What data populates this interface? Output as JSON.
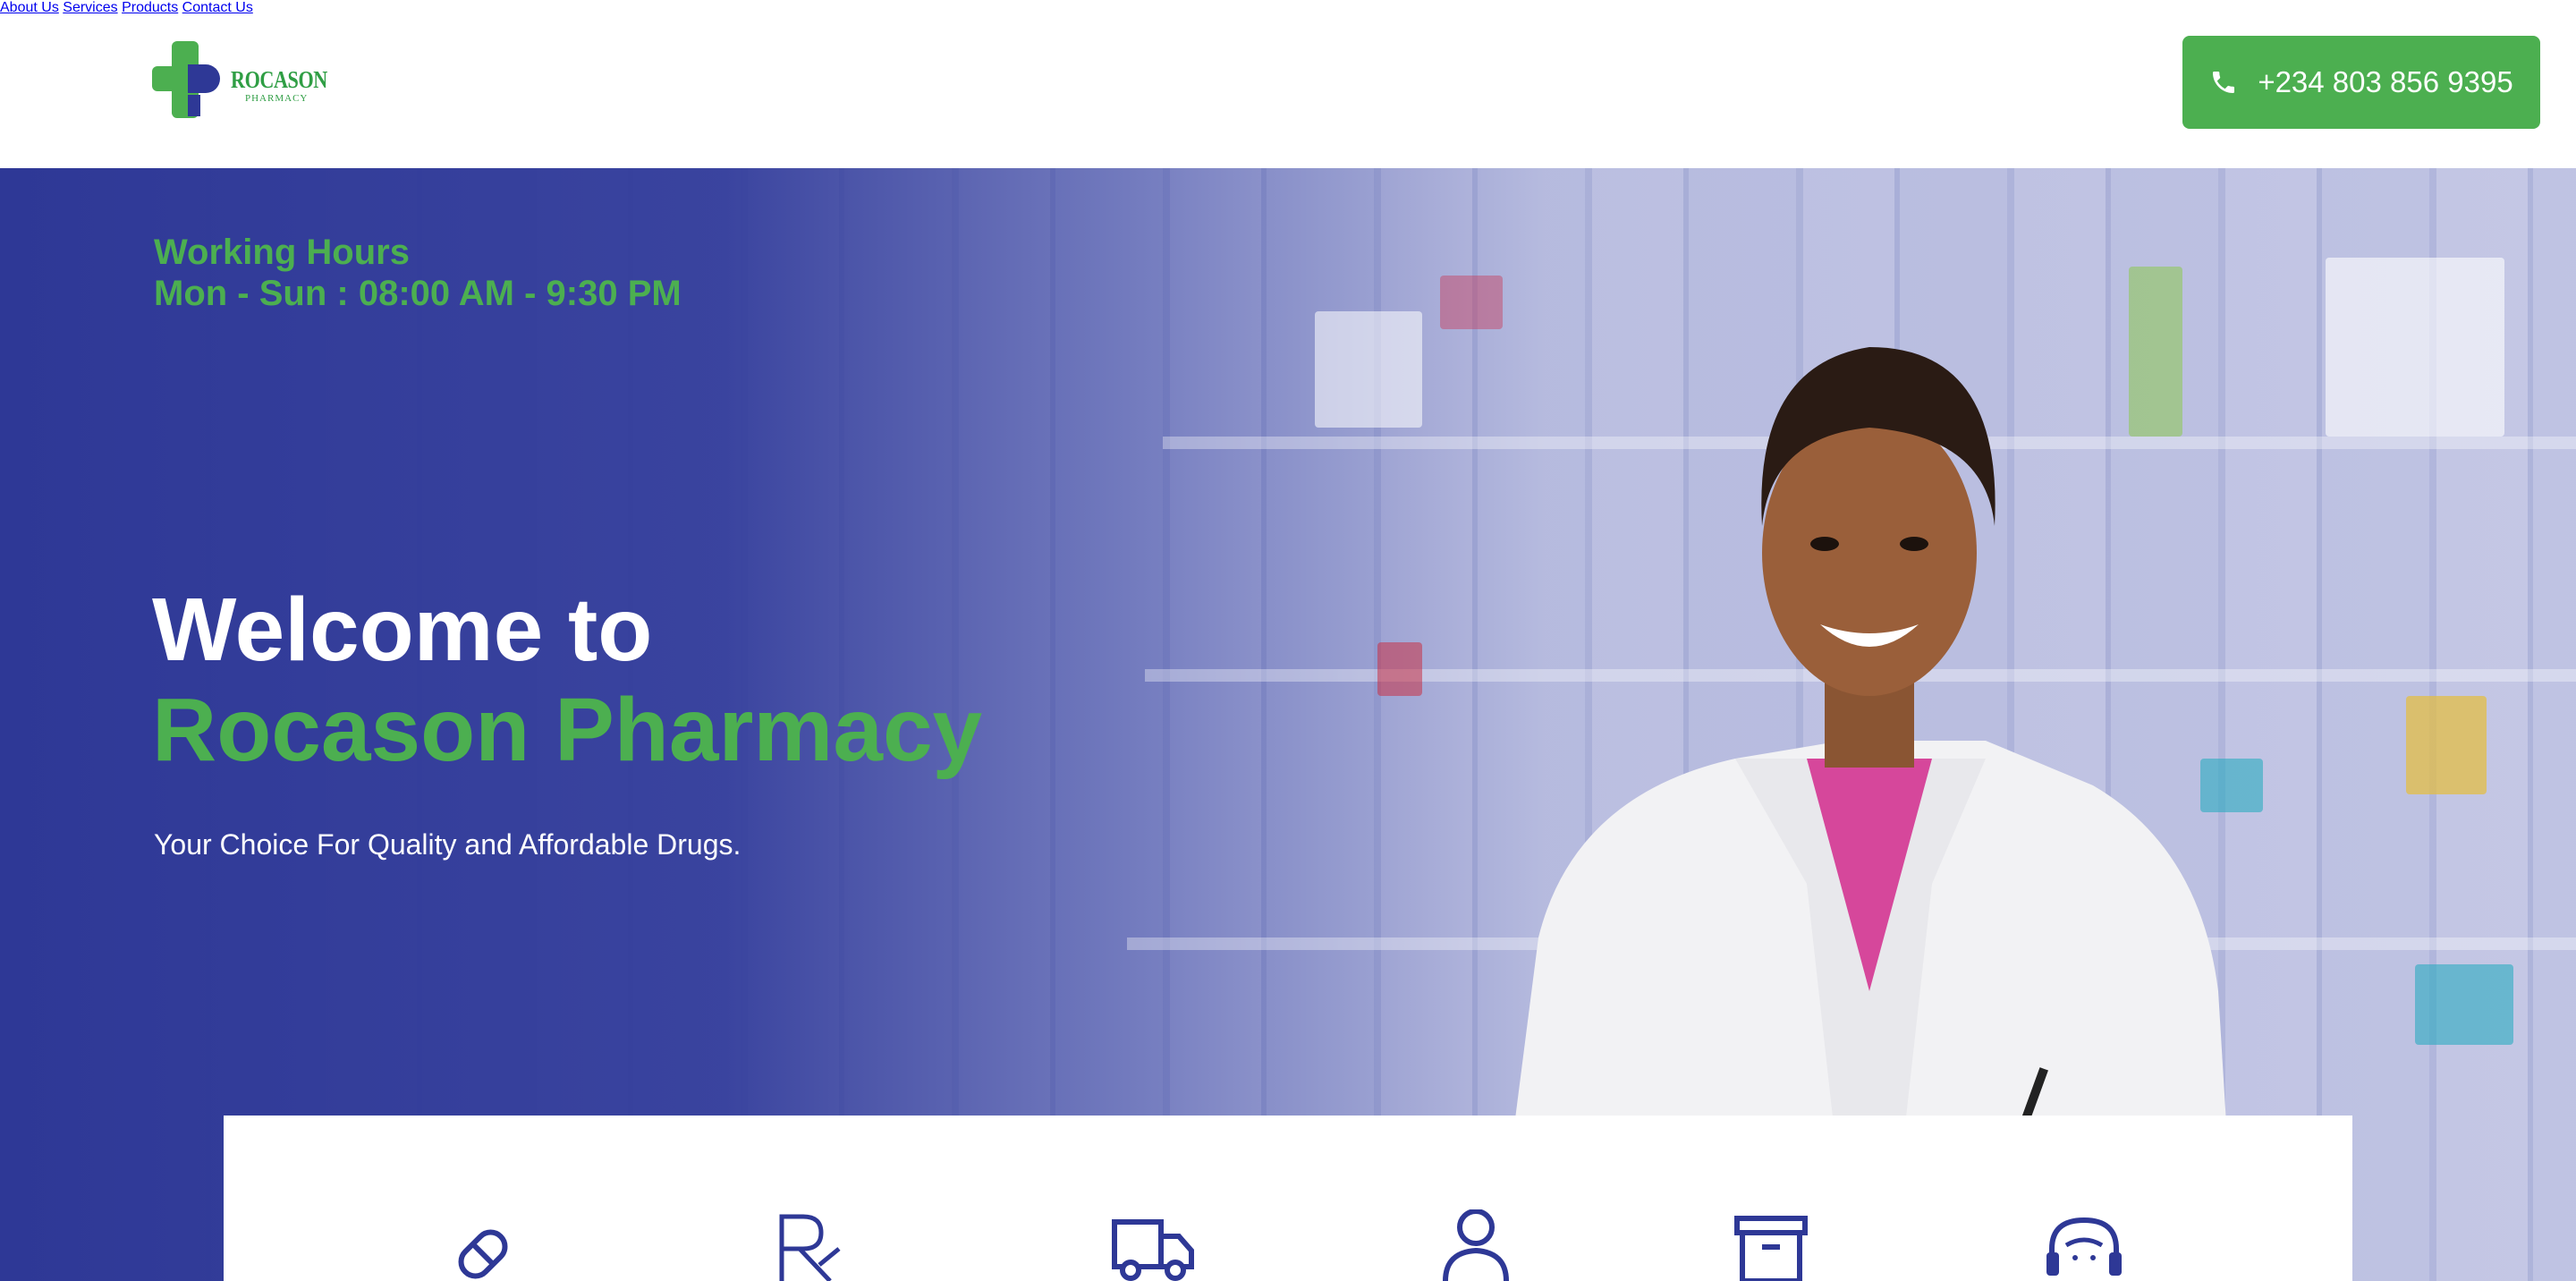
{
  "header": {
    "logo": {
      "text": "ROCASON",
      "subtext": "PHARMACY"
    },
    "nav": [
      {
        "label": "About Us"
      },
      {
        "label": "Services"
      },
      {
        "label": "Products"
      },
      {
        "label": "Contact Us"
      }
    ],
    "phone": {
      "label": "+234 803 856 9395",
      "icon": "phone-icon"
    }
  },
  "hero": {
    "hours_title": "Working Hours",
    "hours_text": "Mon - Sun : 08:00 AM - 9:30 PM",
    "welcome": "Welcome to",
    "pharmacy_name": "Rocason Pharmacy",
    "tagline": "Your Choice For Quality and Affordable Drugs."
  },
  "services": {
    "icons": [
      "pill-icon",
      "prescription-icon",
      "delivery-truck-icon",
      "pharmacist-icon",
      "archive-box-icon",
      "support-headset-icon"
    ]
  },
  "colors": {
    "brand_green": "#4caf50",
    "brand_blue": "#2e3896",
    "icon_blue": "#2e3896"
  }
}
